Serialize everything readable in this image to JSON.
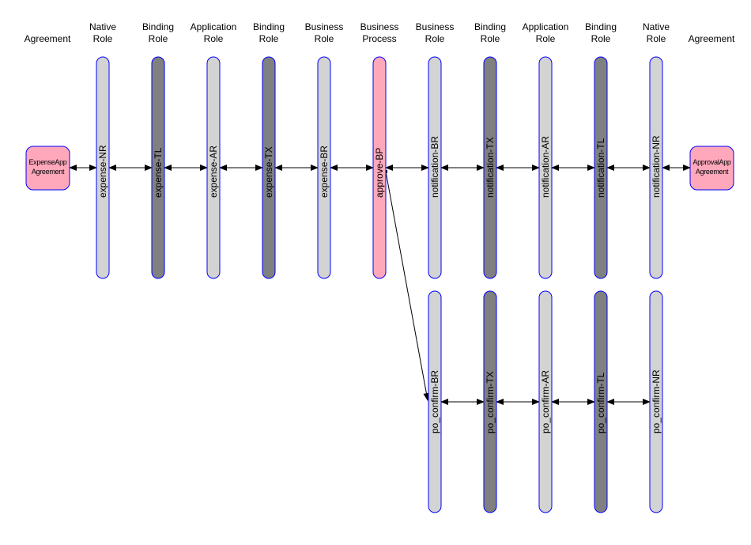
{
  "colors": {
    "role_fill": "#d3d3d3",
    "binding_fill": "#808080",
    "process_fill": "#ffa8bc",
    "border": "#0000ff",
    "connector": "#000000"
  },
  "columns": [
    {
      "header": [
        "Agreement"
      ]
    },
    {
      "header": [
        "Native",
        "Role"
      ]
    },
    {
      "header": [
        "Binding",
        "Role"
      ]
    },
    {
      "header": [
        "Application",
        "Role"
      ]
    },
    {
      "header": [
        "Binding",
        "Role"
      ]
    },
    {
      "header": [
        "Business",
        "Role"
      ]
    },
    {
      "header": [
        "Business",
        "Process"
      ]
    },
    {
      "header": [
        "Business",
        "Role"
      ]
    },
    {
      "header": [
        "Binding",
        "Role"
      ]
    },
    {
      "header": [
        "Application",
        "Role"
      ]
    },
    {
      "header": [
        "Binding",
        "Role"
      ]
    },
    {
      "header": [
        "Native",
        "Role"
      ]
    },
    {
      "header": [
        "Agreement"
      ]
    }
  ],
  "agreements": [
    {
      "label": [
        "ExpenseApp",
        "Agreement"
      ]
    },
    {
      "label": [
        "ApprovalApp",
        "Agreement"
      ]
    }
  ],
  "rows": [
    {
      "lanes": [
        {
          "label": "expense-NR",
          "kind": "role"
        },
        {
          "label": "expense-TL",
          "kind": "binding"
        },
        {
          "label": "expense-AR",
          "kind": "role"
        },
        {
          "label": "expense-TX",
          "kind": "binding"
        },
        {
          "label": "expense-BR",
          "kind": "role"
        },
        {
          "label": "approve-BP",
          "kind": "process"
        },
        {
          "label": "notification-BR",
          "kind": "role"
        },
        {
          "label": "notification-TX",
          "kind": "binding"
        },
        {
          "label": "notification-AR",
          "kind": "role"
        },
        {
          "label": "notification-TL",
          "kind": "binding"
        },
        {
          "label": "notification-NR",
          "kind": "role"
        }
      ]
    },
    {
      "lanes": [
        {
          "label": "po_confirm-BR",
          "kind": "role"
        },
        {
          "label": "po_confirm-TX",
          "kind": "binding"
        },
        {
          "label": "po_confirm-AR",
          "kind": "role"
        },
        {
          "label": "po_confirm-TL",
          "kind": "binding"
        },
        {
          "label": "po_confirm-NR",
          "kind": "role"
        }
      ]
    }
  ]
}
